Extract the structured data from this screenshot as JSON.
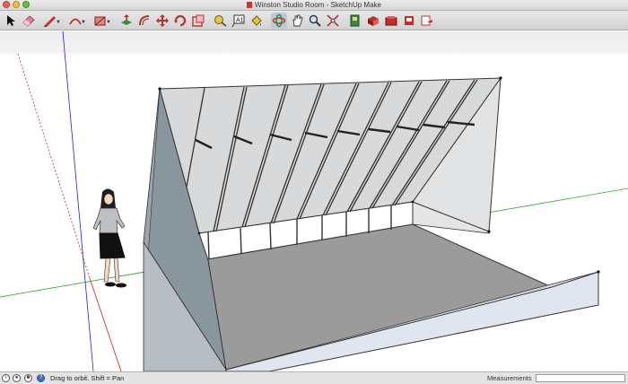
{
  "window": {
    "title": "Winston Studio Room - SketchUp Make",
    "traffic_lights": [
      "#ee5b52",
      "#f5bd2f",
      "#5fc43a"
    ]
  },
  "toolbar": {
    "tools": [
      {
        "icon": "select-arrow-icon"
      },
      {
        "icon": "eraser-icon"
      },
      {
        "icon": "pencil-line-icon",
        "dropdown": true
      },
      {
        "icon": "arc-icon",
        "dropdown": true
      },
      {
        "icon": "rectangle-icon",
        "dropdown": true
      },
      {
        "icon": "push-pull-icon"
      },
      {
        "icon": "offset-icon"
      },
      {
        "icon": "move-icon"
      },
      {
        "icon": "rotate-icon"
      },
      {
        "icon": "scale-icon"
      },
      {
        "icon": "tape-measure-icon"
      },
      {
        "icon": "text-icon"
      },
      {
        "icon": "paint-bucket-icon"
      },
      {
        "icon": "orbit-icon"
      },
      {
        "icon": "pan-icon"
      },
      {
        "icon": "zoom-icon"
      },
      {
        "icon": "zoom-extents-icon"
      },
      {
        "icon": "warehouse-icon"
      },
      {
        "icon": "share-model-icon"
      },
      {
        "icon": "extension-warehouse-icon"
      },
      {
        "icon": "layout-icon"
      },
      {
        "icon": "send-to-layout-icon"
      }
    ]
  },
  "statusbar": {
    "icons": [
      "geo-location-icon",
      "credits-icon",
      "user-icon",
      "help-icon"
    ],
    "message": "Drag to orbit.  Shift = Pan",
    "measurements_label": "Measurements",
    "measurements_value": ""
  },
  "colors": {
    "axis_red": "#c82020",
    "axis_green": "#2fae2f",
    "axis_blue": "#2020d0",
    "wall_dark": "#8a969e",
    "wall_light": "#d6d8da",
    "floor": "#9b9b9b"
  }
}
